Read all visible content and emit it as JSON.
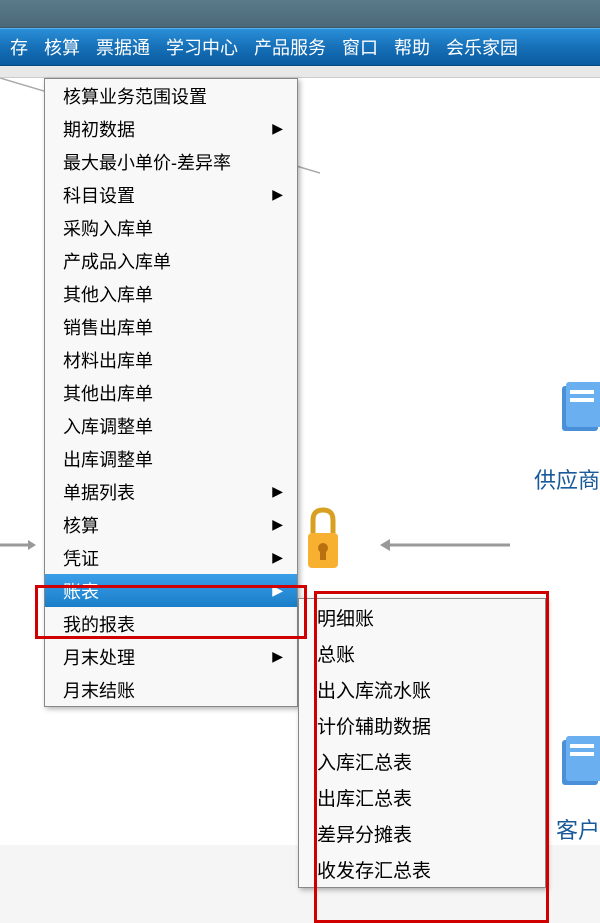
{
  "menubar": {
    "items": [
      {
        "label": "存"
      },
      {
        "label": "核算"
      },
      {
        "label": "票据通"
      },
      {
        "label": "学习中心"
      },
      {
        "label": "产品服务"
      },
      {
        "label": "窗口"
      },
      {
        "label": "帮助"
      },
      {
        "label": "会乐家园"
      }
    ]
  },
  "dropdown": {
    "items": [
      {
        "label": "核算业务范围设置",
        "hasSubmenu": false
      },
      {
        "label": "期初数据",
        "hasSubmenu": true
      },
      {
        "label": "最大最小单价-差异率",
        "hasSubmenu": false
      },
      {
        "label": "科目设置",
        "hasSubmenu": true
      },
      {
        "label": "采购入库单",
        "hasSubmenu": false
      },
      {
        "label": "产成品入库单",
        "hasSubmenu": false
      },
      {
        "label": "其他入库单",
        "hasSubmenu": false
      },
      {
        "label": "销售出库单",
        "hasSubmenu": false
      },
      {
        "label": "材料出库单",
        "hasSubmenu": false
      },
      {
        "label": "其他出库单",
        "hasSubmenu": false
      },
      {
        "label": "入库调整单",
        "hasSubmenu": false
      },
      {
        "label": "出库调整单",
        "hasSubmenu": false
      },
      {
        "label": "单据列表",
        "hasSubmenu": true
      },
      {
        "label": "核算",
        "hasSubmenu": true
      },
      {
        "label": "凭证",
        "hasSubmenu": true
      },
      {
        "label": "账表",
        "hasSubmenu": true,
        "highlighted": true
      },
      {
        "label": "我的报表",
        "hasSubmenu": false
      },
      {
        "label": "月末处理",
        "hasSubmenu": true
      },
      {
        "label": "月末结账",
        "hasSubmenu": false
      }
    ]
  },
  "submenu": {
    "items": [
      {
        "label": "明细账"
      },
      {
        "label": "总账"
      },
      {
        "label": "出入库流水账"
      },
      {
        "label": "计价辅助数据"
      },
      {
        "label": "入库汇总表"
      },
      {
        "label": "出库汇总表"
      },
      {
        "label": "差异分摊表"
      },
      {
        "label": "收发存汇总表"
      }
    ]
  },
  "background": {
    "label1": "供应商",
    "label2": "客户"
  }
}
